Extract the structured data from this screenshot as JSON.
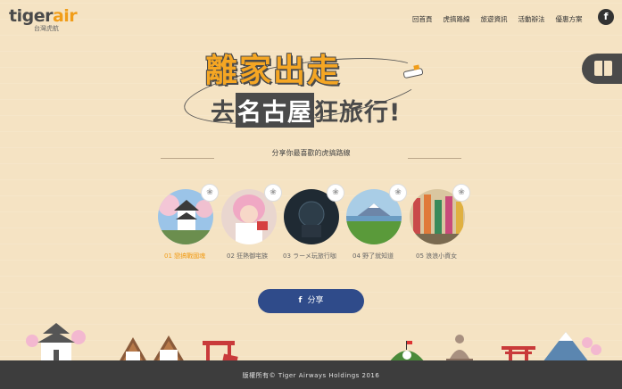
{
  "logo": {
    "brand_dark": "tiger",
    "brand_accent": "air",
    "sub": "台灣虎航"
  },
  "nav": [
    "回首頁",
    "虎搞路線",
    "旅遊資訊",
    "活動辦法",
    "優惠方案"
  ],
  "facebook_icon": "f",
  "title": {
    "line1": "離家出走",
    "line2_pre": "去",
    "line2_box": "名古屋",
    "line2_post": "狂旅行!"
  },
  "section_heading": "分享你最喜歡的虎搞路線",
  "routes": [
    {
      "label": "01 戀搞戰國魂",
      "active": true
    },
    {
      "label": "02 狂熱御宅族",
      "active": false
    },
    {
      "label": "03 ラーメ玩旅行咖",
      "active": false
    },
    {
      "label": "04 野了就知道",
      "active": false
    },
    {
      "label": "05 浪浪小資女",
      "active": false
    }
  ],
  "share_button": {
    "icon": "f",
    "label": "分享"
  },
  "footer": {
    "copyright": "版權所有© Tiger Airways Holdings 2016"
  },
  "colors": {
    "accent": "#f19d19",
    "background": "#f5e3c3",
    "share": "#2f4b8a",
    "ground": "#3d3d3d"
  }
}
